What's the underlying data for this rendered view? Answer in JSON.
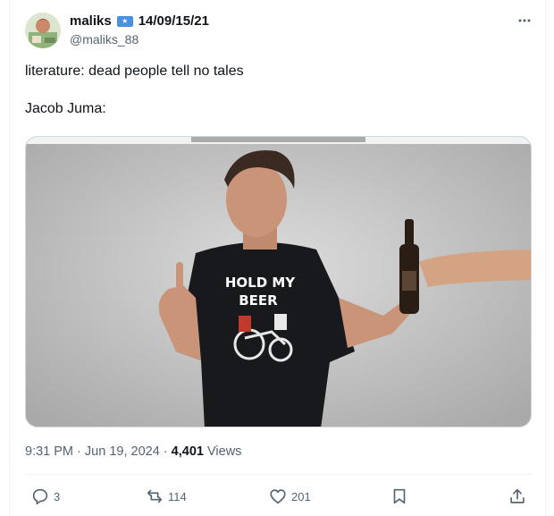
{
  "tweet": {
    "author": {
      "display_name": "maliks",
      "name_suffix": "14/09/15/21",
      "handle": "@maliks_88",
      "flag_icon": "somalia-flag-icon"
    },
    "text": "literature: dead people tell no tales\n\nJacob Juma:",
    "media": {
      "shirt_text_line1": "HOLD MY",
      "shirt_text_line2": "BEER"
    },
    "meta": {
      "time": "9:31 PM",
      "separator": "·",
      "date": "Jun 19, 2024",
      "views_count": "4,401",
      "views_label": "Views"
    },
    "actions": {
      "replies": "3",
      "reposts": "114",
      "likes": "201"
    }
  },
  "colors": {
    "text_primary": "#0f1419",
    "text_secondary": "#536471",
    "border": "#cfd9de",
    "flag_blue": "#4a90e2"
  }
}
